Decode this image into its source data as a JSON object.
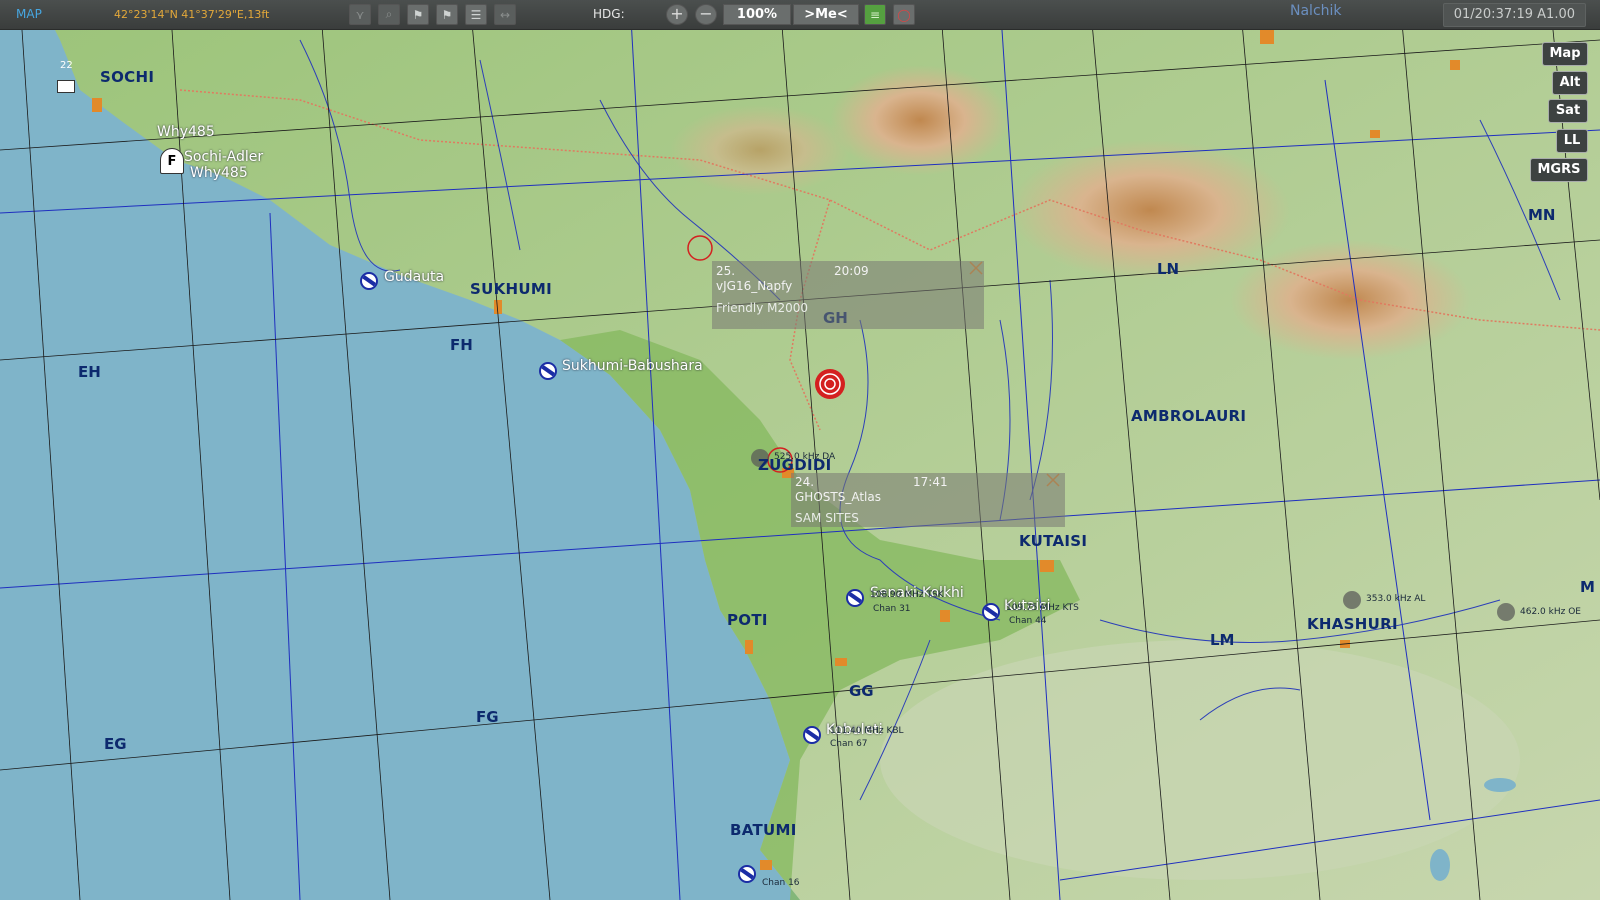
{
  "topbar": {
    "mode_label": "MAP",
    "coords": "42°23'14\"N 41°37'29\"E,13ft",
    "hdg_label": "HDG:",
    "zoom": "100%",
    "me_button": ">Me<",
    "clock": "01/20:37:19 A1.00"
  },
  "layers": [
    "Map",
    "Alt",
    "Sat",
    "LL",
    "MGRS"
  ],
  "colors": {
    "sea": "#7fb4c9",
    "lowland": "#8fbf6b",
    "hills": "#b7cf9a",
    "mountain": "#d6b79a",
    "grid_line": "#1f2fbf",
    "city_label": "#0d2a6e",
    "threat": "#d42020",
    "airfield": "#1b2da5"
  },
  "cities": [
    {
      "name": "SOCHI"
    },
    {
      "name": "SUKHUMI"
    },
    {
      "name": "ZUGDIDI"
    },
    {
      "name": "POTI"
    },
    {
      "name": "BATUMI"
    },
    {
      "name": "KUTAISI"
    },
    {
      "name": "AMBROLAURI"
    },
    {
      "name": "KHASHURI"
    }
  ],
  "grid_labels": [
    "EH",
    "FH",
    "GH",
    "LN",
    "MN",
    "EG",
    "FG",
    "GG",
    "LM"
  ],
  "airfields": [
    {
      "name": "Gudauta"
    },
    {
      "name": "Sukhumi-Babushara"
    },
    {
      "name": "Sochi-Adler"
    },
    {
      "name": "Kobuleti"
    },
    {
      "name": "Senaki-Kolkhi"
    },
    {
      "name": "Kutaisi"
    }
  ],
  "callsign": "Why485",
  "sochi_num": "22",
  "nav_aids": [
    {
      "text": "525.0 kHz DA"
    },
    {
      "text": "353.0 kHz AL"
    },
    {
      "text": "462.0 kHz OE"
    },
    {
      "text": "108.90 MHz TSK"
    },
    {
      "text": "Chan 31"
    },
    {
      "text": "109.75 MHz KTS"
    },
    {
      "text": "Chan 44"
    },
    {
      "text": "111.40 MHz KBL"
    },
    {
      "text": "Chan 67"
    },
    {
      "text": "Chan 16"
    }
  ],
  "waypoints": [
    {
      "num": "25.",
      "time": "20:09",
      "name": "vJG16_Napfy",
      "desc": "Friendly M2000"
    },
    {
      "num": "24.",
      "time": "17:41",
      "name": "GHOSTS_Atlas",
      "desc": "SAM SITES"
    }
  ],
  "edge_labels": [
    "Nalchik",
    "M"
  ]
}
